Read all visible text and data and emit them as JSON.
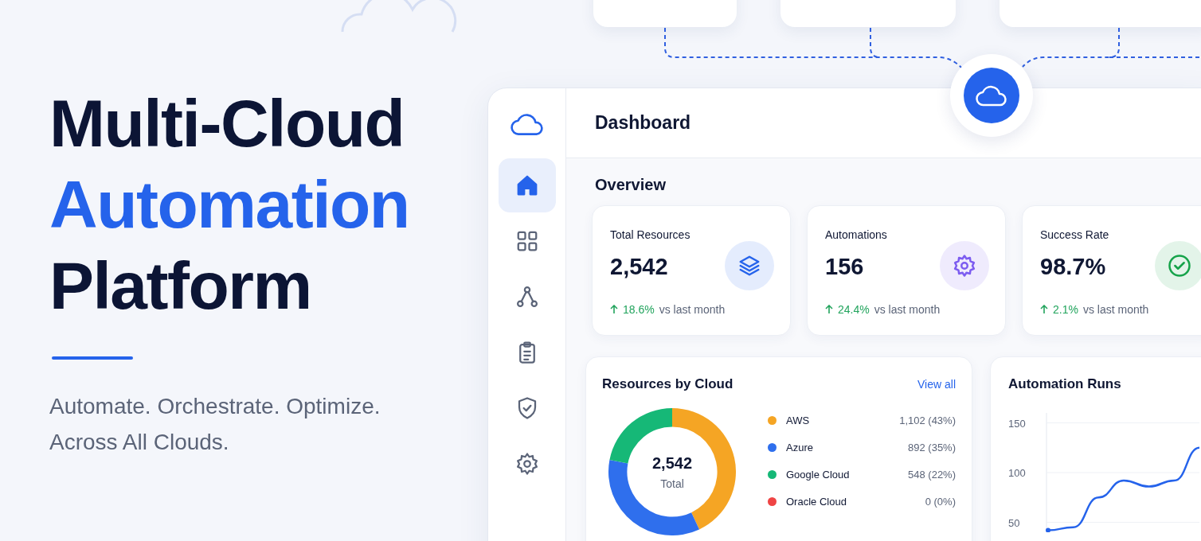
{
  "hero": {
    "title_lines": [
      {
        "text": "Multi-Cloud",
        "accent": false
      },
      {
        "text": "Automation",
        "accent": true
      },
      {
        "text": "Platform",
        "accent": false
      }
    ],
    "tagline_lines": [
      "Automate. Orchestrate. Optimize.",
      "Across All Clouds."
    ]
  },
  "dashboard": {
    "title": "Dashboard",
    "sidebar": {
      "items": [
        {
          "kind": "home",
          "selected": true
        },
        {
          "kind": "grid",
          "selected": false
        },
        {
          "kind": "nodes",
          "selected": false
        },
        {
          "kind": "clipboard",
          "selected": false
        },
        {
          "kind": "shield",
          "selected": false
        },
        {
          "kind": "gear",
          "selected": false
        }
      ]
    },
    "overview_title": "Overview",
    "stats": [
      {
        "label": "Total Resources",
        "value": "2,542",
        "change": "18.6%",
        "suffix": "vs last month",
        "kind": "layers",
        "color": "#2563eb"
      },
      {
        "label": "Automations",
        "value": "156",
        "change": "24.4%",
        "suffix": "vs last month",
        "kind": "gear",
        "color": "#7c5cf0"
      },
      {
        "label": "Success Rate",
        "value": "98.7%",
        "change": "2.1%",
        "suffix": "vs last month",
        "kind": "check",
        "color": "#16a34a"
      }
    ],
    "resources": {
      "title": "Resources by Cloud",
      "link": "View all",
      "total": "2,542",
      "total_label": "Total",
      "legend": [
        {
          "reading": "1,102 (43%)",
          "color": "#f5a524"
        },
        {
          "reading": "892 (35%)",
          "color": "#2f6fed"
        },
        {
          "reading": "548 (22%)",
          "color": "#16b877"
        },
        {
          "reading": "0 (0%)",
          "color": "#ef4444"
        }
      ],
      "chart_data": {
        "type": "donut",
        "categories": [
          "AWS",
          "Azure",
          "Google Cloud",
          "Oracle Cloud"
        ],
        "values": [
          43,
          35,
          22,
          0
        ]
      }
    },
    "runs": {
      "title": "Automation Runs",
      "chart_data": {
        "type": "line",
        "ylim": [
          40,
          160
        ],
        "yticks": [
          50,
          100,
          150
        ],
        "grid": true,
        "series": [
          {
            "color": "#2563eb",
            "values": [
              42,
              45,
              75,
              92,
              86,
              92,
              125
            ]
          }
        ]
      }
    }
  }
}
